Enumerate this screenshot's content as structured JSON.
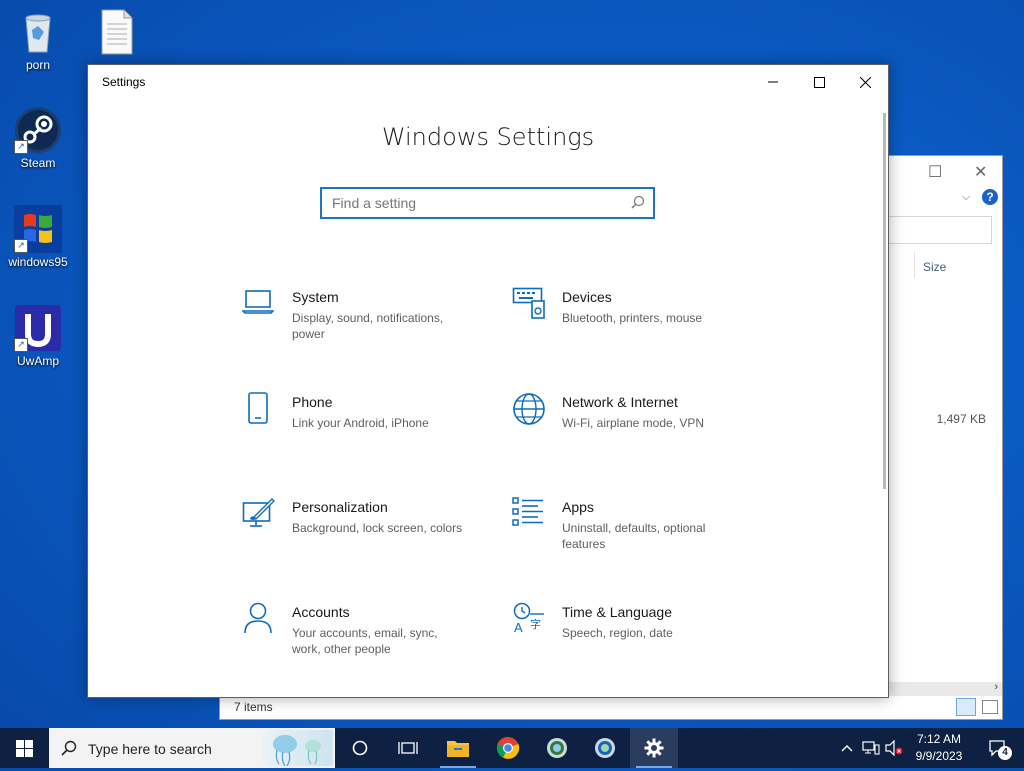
{
  "desktop": {
    "icons": [
      {
        "label": "porn"
      },
      {
        "label": "Steam"
      },
      {
        "label": "windows95"
      },
      {
        "label": "UwAmp"
      }
    ]
  },
  "explorer": {
    "column_size": "Size",
    "file_size": "1,497 KB",
    "status": "7 items"
  },
  "settings": {
    "window_title": "Settings",
    "heading": "Windows Settings",
    "search_placeholder": "Find a setting",
    "tiles": [
      {
        "name": "System",
        "desc": "Display, sound, notifications, power",
        "icon": "laptop-icon"
      },
      {
        "name": "Devices",
        "desc": "Bluetooth, printers, mouse",
        "icon": "keyboard-devices-icon"
      },
      {
        "name": "Phone",
        "desc": "Link your Android, iPhone",
        "icon": "phone-icon"
      },
      {
        "name": "Network & Internet",
        "desc": "Wi-Fi, airplane mode, VPN",
        "icon": "globe-icon"
      },
      {
        "name": "Personalization",
        "desc": "Background, lock screen, colors",
        "icon": "paint-icon"
      },
      {
        "name": "Apps",
        "desc": "Uninstall, defaults, optional features",
        "icon": "apps-list-icon"
      },
      {
        "name": "Accounts",
        "desc": "Your accounts, email, sync, work, other people",
        "icon": "person-icon"
      },
      {
        "name": "Time & Language",
        "desc": "Speech, region, date",
        "icon": "time-language-icon"
      }
    ]
  },
  "taskbar": {
    "search_text": "Type here to search",
    "time": "7:12 AM",
    "date": "9/9/2023",
    "notification_count": "4"
  },
  "colors": {
    "accent": "#0f6cbd",
    "taskbar": "#0f2142"
  }
}
